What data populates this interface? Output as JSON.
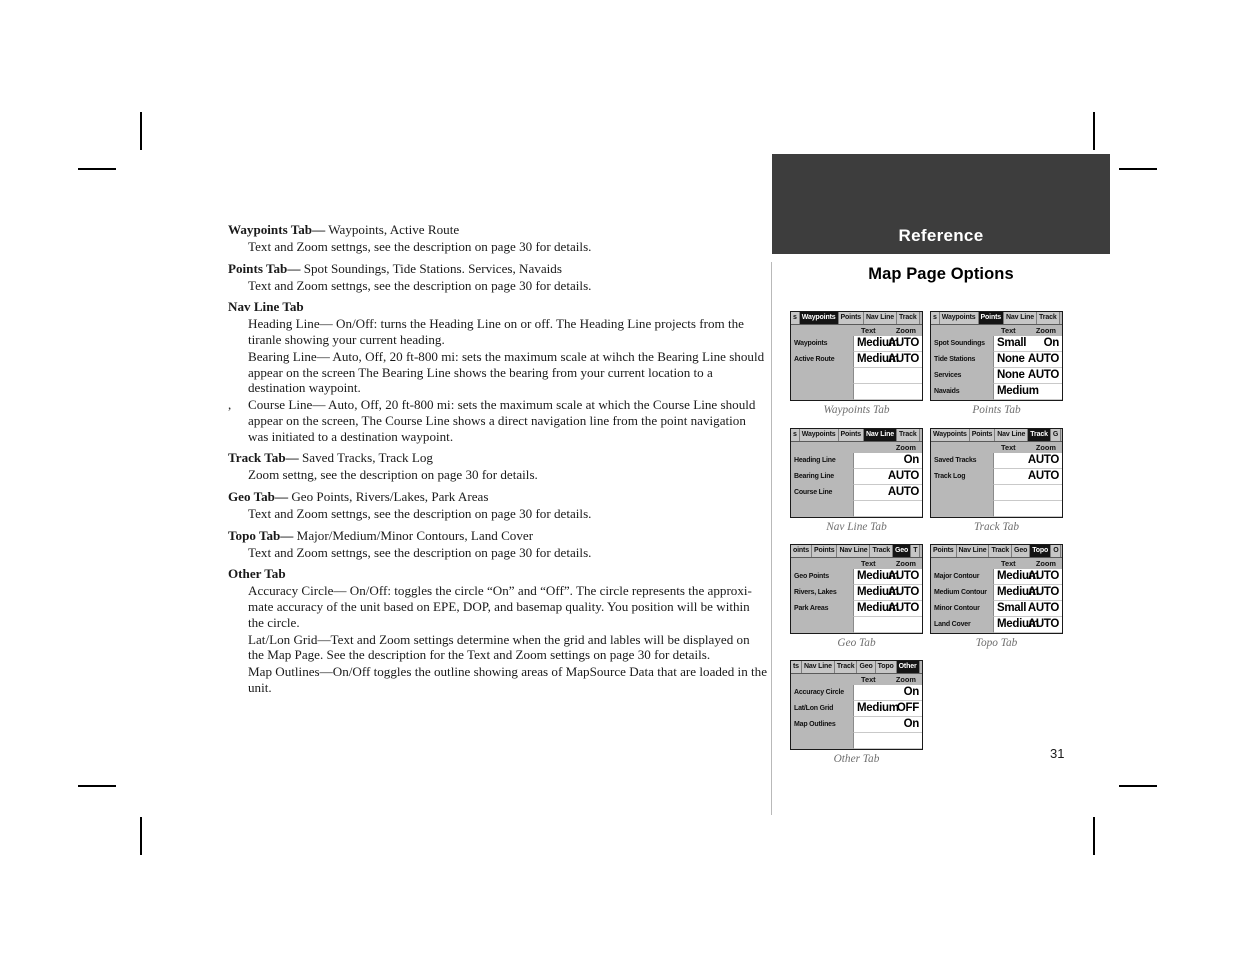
{
  "page": {
    "number": "31",
    "banner_title": "Reference",
    "section_title": "Map Page Options"
  },
  "body": {
    "paragraphs": [
      {
        "id": "p1",
        "style": "lead",
        "bold": "Waypoints Tab—",
        "text": " Waypoints, Active Route"
      },
      {
        "id": "p2",
        "style": "indent",
        "bold": "",
        "text": "Text and Zoom settngs, see the description on page 30 for details."
      },
      {
        "id": "p3",
        "style": "lead",
        "bold": "Points Tab—",
        "text": " Spot Soundings, Tide Stations. Services, Navaids"
      },
      {
        "id": "p4",
        "style": "indent",
        "bold": "",
        "text": "Text and Zoom settngs, see the description on page 30 for details."
      },
      {
        "id": "p5",
        "style": "lead",
        "bold": "Nav Line Tab",
        "text": ""
      },
      {
        "id": "p6",
        "style": "indent",
        "bold": "",
        "text": "Heading Line— On/Off: turns the Heading Line on or off.  The Heading Line projects from the tiranle showing your current heading."
      },
      {
        "id": "p7",
        "style": "indent",
        "bold": "",
        "text": "Bearing Line— Auto, Off, 20 ft-800 mi: sets the maximum scale at wihch the Bearing Line should appear on the screen  The Bearing Line shows the bearing from your current location to a destination waypoint."
      },
      {
        "id": "p8",
        "style": "indent-hang",
        "bold": "",
        "text": "Course Line— Auto, Off, 20 ft-800 mi: sets the maximum scale at which the Course Line should appear on the screen,  The Course Line shows a direct navigation line from the point navigation was initiated to a destination waypoint.",
        "stray": ","
      },
      {
        "id": "p9",
        "style": "lead",
        "bold": "Track Tab—",
        "text": " Saved Tracks, Track Log"
      },
      {
        "id": "p10",
        "style": "indent",
        "bold": "",
        "text": "Zoom settng, see the description on page 30 for details."
      },
      {
        "id": "p11",
        "style": "lead",
        "bold": "Geo Tab—",
        "text": " Geo Points, Rivers/Lakes, Park Areas"
      },
      {
        "id": "p12",
        "style": "indent",
        "bold": "",
        "text": "Text and Zoom settngs, see the description on page 30 for details."
      },
      {
        "id": "p13",
        "style": "lead",
        "bold": "Topo Tab—",
        "text": " Major/Medium/Minor Contours, Land Cover"
      },
      {
        "id": "p14",
        "style": "indent",
        "bold": "",
        "text": "Text and Zoom settngs, see the description on page 30 for details."
      },
      {
        "id": "p15",
        "style": "lead",
        "bold": "Other Tab",
        "text": ""
      },
      {
        "id": "p16",
        "style": "indent",
        "bold": "",
        "text": "Accuracy Circle— On/Off: toggles the circle “On” and “Off”. The circle represents the approxi-mate accuracy of the unit based on EPE, DOP, and basemap quality. You position will be within the circle."
      },
      {
        "id": "p17",
        "style": "indent",
        "bold": "",
        "text": "Lat/Lon Grid—Text and Zoom settings determine when the grid and lables will be displayed on the Map Page.  See the description for the Text and Zoom settings on page 30 for details."
      },
      {
        "id": "p18",
        "style": "indent",
        "bold": "",
        "text": "Map Outlines—On/Off toggles the outline showing areas of MapSource Data that are loaded in the unit."
      }
    ]
  },
  "figures": [
    {
      "id": "waypoints",
      "caption": "Waypoints Tab",
      "tabs": [
        {
          "label": "s",
          "selected": false
        },
        {
          "label": "Waypoints",
          "selected": true
        },
        {
          "label": "Points",
          "selected": false
        },
        {
          "label": "Nav Line",
          "selected": false
        },
        {
          "label": "Track",
          "selected": false
        }
      ],
      "columns": {
        "text": "Text",
        "zoom": "Zoom"
      },
      "show_text_column": true,
      "rows": [
        {
          "label": "Waypoints",
          "text": "Medium",
          "zoom": "AUTO"
        },
        {
          "label": "Active Route",
          "text": "Medium",
          "zoom": "AUTO"
        },
        {
          "label": "",
          "text": "",
          "zoom": ""
        },
        {
          "label": "",
          "text": "",
          "zoom": ""
        }
      ]
    },
    {
      "id": "points",
      "caption": "Points Tab",
      "tabs": [
        {
          "label": "s",
          "selected": false
        },
        {
          "label": "Waypoints",
          "selected": false
        },
        {
          "label": "Points",
          "selected": true
        },
        {
          "label": "Nav Line",
          "selected": false
        },
        {
          "label": "Track",
          "selected": false
        }
      ],
      "columns": {
        "text": "Text",
        "zoom": "Zoom"
      },
      "show_text_column": true,
      "rows": [
        {
          "label": "Spot Soundings",
          "text": "Small",
          "zoom": "On"
        },
        {
          "label": "Tide Stations",
          "text": "None",
          "zoom": "AUTO"
        },
        {
          "label": "Services",
          "text": "None",
          "zoom": "AUTO"
        },
        {
          "label": "Navaids",
          "text": "Medium",
          "zoom": ""
        }
      ]
    },
    {
      "id": "navline",
      "caption": "Nav Line Tab",
      "tabs": [
        {
          "label": "s",
          "selected": false
        },
        {
          "label": "Waypoints",
          "selected": false
        },
        {
          "label": "Points",
          "selected": false
        },
        {
          "label": "Nav Line",
          "selected": true
        },
        {
          "label": "Track",
          "selected": false
        }
      ],
      "columns": {
        "text": "",
        "zoom": "Zoom"
      },
      "show_text_column": false,
      "rows": [
        {
          "label": "Heading Line",
          "text": "",
          "zoom": "On"
        },
        {
          "label": "Bearing Line",
          "text": "",
          "zoom": "AUTO"
        },
        {
          "label": "Course Line",
          "text": "",
          "zoom": "AUTO"
        },
        {
          "label": "",
          "text": "",
          "zoom": ""
        }
      ]
    },
    {
      "id": "track",
      "caption": "Track Tab",
      "tabs": [
        {
          "label": "Waypoints",
          "selected": false
        },
        {
          "label": "Points",
          "selected": false
        },
        {
          "label": "Nav Line",
          "selected": false
        },
        {
          "label": "Track",
          "selected": true
        },
        {
          "label": "G",
          "selected": false
        }
      ],
      "columns": {
        "text": "Text",
        "zoom": "Zoom"
      },
      "show_text_column": true,
      "rows": [
        {
          "label": "Saved Tracks",
          "text": "",
          "zoom": "AUTO"
        },
        {
          "label": "Track Log",
          "text": "",
          "zoom": "AUTO"
        },
        {
          "label": "",
          "text": "",
          "zoom": ""
        },
        {
          "label": "",
          "text": "",
          "zoom": ""
        }
      ]
    },
    {
      "id": "geo",
      "caption": "Geo Tab",
      "tabs": [
        {
          "label": "oints",
          "selected": false
        },
        {
          "label": "Points",
          "selected": false
        },
        {
          "label": "Nav Line",
          "selected": false
        },
        {
          "label": "Track",
          "selected": false
        },
        {
          "label": "Geo",
          "selected": true
        },
        {
          "label": "T",
          "selected": false
        }
      ],
      "columns": {
        "text": "Text",
        "zoom": "Zoom"
      },
      "show_text_column": true,
      "rows": [
        {
          "label": "Geo Points",
          "text": "Medium",
          "zoom": "AUTO"
        },
        {
          "label": "Rivers, Lakes",
          "text": "Medium",
          "zoom": "AUTO"
        },
        {
          "label": "Park Areas",
          "text": "Medium",
          "zoom": "AUTO"
        },
        {
          "label": "",
          "text": "",
          "zoom": ""
        }
      ]
    },
    {
      "id": "topo",
      "caption": "Topo Tab",
      "tabs": [
        {
          "label": "Points",
          "selected": false
        },
        {
          "label": "Nav Line",
          "selected": false
        },
        {
          "label": "Track",
          "selected": false
        },
        {
          "label": "Geo",
          "selected": false
        },
        {
          "label": "Topo",
          "selected": true
        },
        {
          "label": "O",
          "selected": false
        }
      ],
      "columns": {
        "text": "Text",
        "zoom": "Zoom"
      },
      "show_text_column": true,
      "rows": [
        {
          "label": "Major Contour",
          "text": "Medium",
          "zoom": "AUTO"
        },
        {
          "label": "Medium Contour",
          "text": "Medium",
          "zoom": "AUTO"
        },
        {
          "label": "Minor Contour",
          "text": "Small",
          "zoom": "AUTO"
        },
        {
          "label": "Land Cover",
          "text": "Medium",
          "zoom": "AUTO"
        }
      ]
    },
    {
      "id": "other",
      "caption": "Other Tab",
      "tabs": [
        {
          "label": "ts",
          "selected": false
        },
        {
          "label": "Nav Line",
          "selected": false
        },
        {
          "label": "Track",
          "selected": false
        },
        {
          "label": "Geo",
          "selected": false
        },
        {
          "label": "Topo",
          "selected": false
        },
        {
          "label": "Other",
          "selected": true
        }
      ],
      "columns": {
        "text": "Text",
        "zoom": "Zoom"
      },
      "show_text_column": true,
      "rows": [
        {
          "label": "Accuracy Circle",
          "text": "",
          "zoom": "On"
        },
        {
          "label": "Lat/Lon Grid",
          "text": "Medium",
          "zoom": "OFF"
        },
        {
          "label": "Map Outlines",
          "text": "",
          "zoom": "On"
        },
        {
          "label": "",
          "text": "",
          "zoom": ""
        }
      ]
    }
  ],
  "colors": {
    "banner_bg": "#3d3d3d",
    "screen_panel": "#b8b8b8",
    "screen_border": "#1a1a1a",
    "caption": "#6e6e6e",
    "rule": "#b9b9b9"
  }
}
